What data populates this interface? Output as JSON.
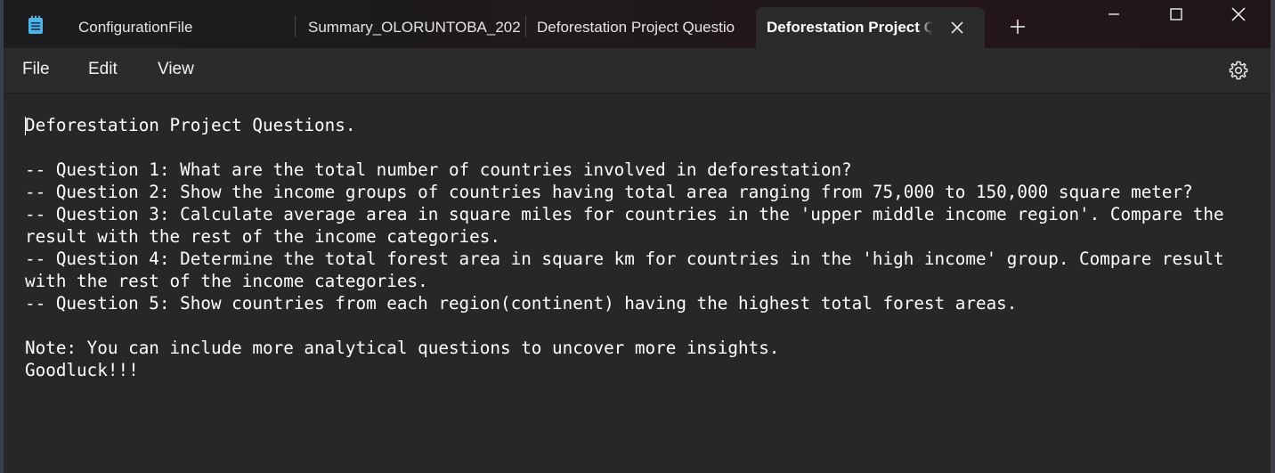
{
  "app": {
    "icon": "notepad-icon"
  },
  "tabs": [
    {
      "label": "ConfigurationFile"
    },
    {
      "label": "Summary_OLORUNTOBA_202"
    },
    {
      "label": "Deforestation Project Questio"
    },
    {
      "label": "Deforestation Project Q"
    }
  ],
  "menu": {
    "file": "File",
    "edit": "Edit",
    "view": "View"
  },
  "document": {
    "lines": [
      "Deforestation Project Questions.",
      "",
      "-- Question 1: What are the total number of countries involved in deforestation?",
      "-- Question 2: Show the income groups of countries having total area ranging from 75,000 to 150,000 square meter?",
      "-- Question 3: Calculate average area in square miles for countries in the 'upper middle income region'. Compare the",
      "result with the rest of the income categories.",
      "-- Question 4: Determine the total forest area in square km for countries in the 'high income' group. Compare result",
      "with the rest of the income categories.",
      "-- Question 5: Show countries from each region(continent) having the highest total forest areas.",
      "",
      "Note: You can include more analytical questions to uncover more insights.",
      "Goodluck!!!"
    ]
  },
  "colors": {
    "background": "#272727",
    "menubar": "#2b2b2b",
    "text": "#ffffff",
    "app_icon_accent": "#4fb3e8"
  }
}
